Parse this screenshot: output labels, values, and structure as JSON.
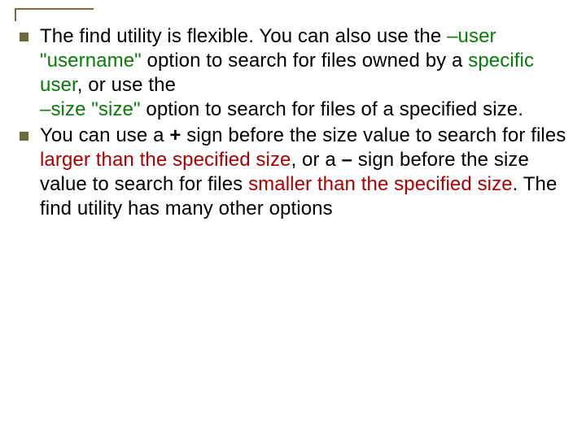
{
  "slide": {
    "bullets": [
      {
        "pre1": "The find utility is flexible. You can also use the ",
        "opt1": "–user \"username\"",
        "mid1": " option to search for files owned by a ",
        "emph1": "specific user",
        "post1": ", or use the ",
        "opt2": "–size \"size\"",
        "mid2": " option to search for files of a specified size."
      },
      {
        "pre1": "You can use a ",
        "plus": "+",
        "mid1": " sign before the size value to search for files ",
        "larger": "larger than the specified size",
        "mid2": ", or a ",
        "minus": "–",
        "mid3": " sign before the size value to search for files ",
        "smaller": "smaller than the specified size",
        "post1": ". The find utility has many other options"
      }
    ]
  }
}
